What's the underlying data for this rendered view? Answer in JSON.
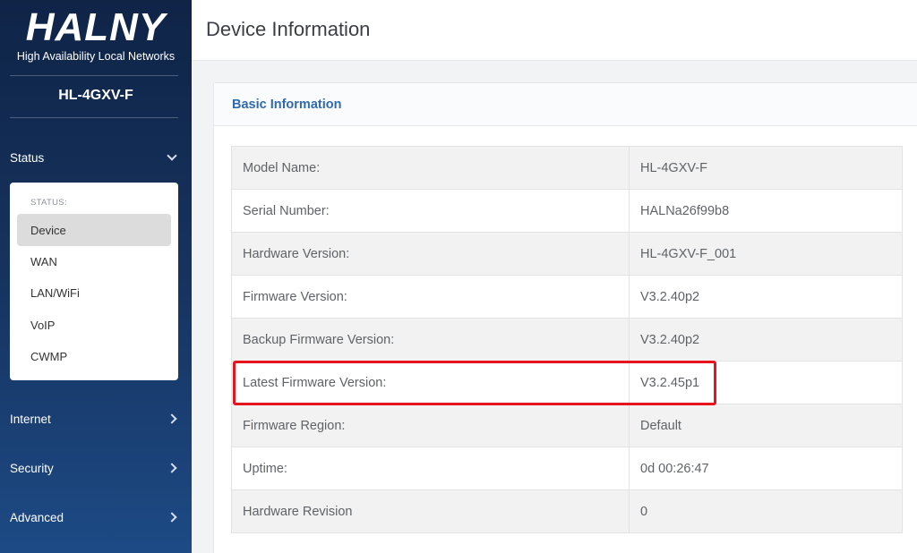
{
  "brand": {
    "logo": "HALNY",
    "tagline": "High Availability Local Networks"
  },
  "device_model": "HL-4GXV-F",
  "sidebar": {
    "status": {
      "label": "Status"
    },
    "submenu": {
      "title": "STATUS:",
      "items": [
        "Device",
        "WAN",
        "LAN/WiFi",
        "VoIP",
        "CWMP"
      ],
      "active": "Device"
    },
    "internet": {
      "label": "Internet"
    },
    "security": {
      "label": "Security"
    },
    "advanced": {
      "label": "Advanced"
    }
  },
  "page": {
    "title": "Device Information"
  },
  "card": {
    "title": "Basic Information",
    "rows": [
      {
        "label": "Model Name:",
        "value": "HL-4GXV-F"
      },
      {
        "label": "Serial Number:",
        "value": "HALNa26f99b8"
      },
      {
        "label": "Hardware Version:",
        "value": "HL-4GXV-F_001"
      },
      {
        "label": "Firmware Version:",
        "value": "V3.2.40p2"
      },
      {
        "label": "Backup Firmware Version:",
        "value": "V3.2.40p2"
      },
      {
        "label": "Latest Firmware Version:",
        "value": "V3.2.45p1"
      },
      {
        "label": "Firmware Region:",
        "value": "Default"
      },
      {
        "label": "Uptime:",
        "value": "0d 00:26:47"
      },
      {
        "label": "Hardware Revision",
        "value": "0"
      }
    ]
  },
  "colors": {
    "sidebar_top": "#0f2447",
    "sidebar_bottom": "#1d4a85",
    "accent": "#2f6ab0",
    "highlight": "#e8141b"
  }
}
